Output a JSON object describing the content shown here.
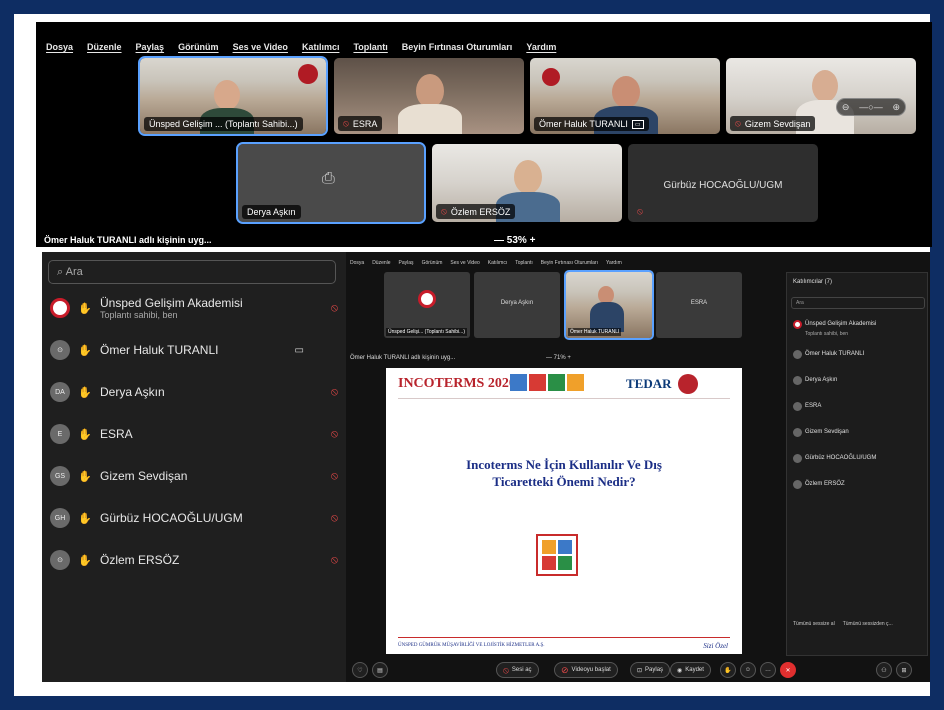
{
  "top_window": {
    "menu": [
      "Dosya",
      "Düzenle",
      "Paylaş",
      "Görünüm",
      "Ses ve Video",
      "Katılımcı",
      "Toplantı",
      "Beyin Fırtınası Oturumları",
      "Yardım"
    ],
    "tiles": [
      {
        "name": "Ünsped Gelişim ... (Toplantı Sahibi...)",
        "muted": false
      },
      {
        "name": "ESRA",
        "muted": true
      },
      {
        "name": "Ömer Haluk TURANLI",
        "muted": false
      },
      {
        "name": "Gizem Sevdişan",
        "muted": true
      },
      {
        "name": "Derya Aşkın",
        "muted": false
      },
      {
        "name": "Özlem ERSÖZ",
        "muted": true
      },
      {
        "name": "Gürbüz HOCAOĞLU/UGM",
        "muted": true
      }
    ],
    "share_info": "Ömer Haluk TURANLI adlı kişinin uyg...",
    "zoom": "—  53%  +"
  },
  "left_panel": {
    "search_placeholder": "Ara",
    "participants": [
      {
        "name": "Ünsped Gelişim Akademisi",
        "sub": "Toplantı sahibi, ben",
        "initials": ""
      },
      {
        "name": "Ömer Haluk TURANLI",
        "sub": "",
        "initials": ""
      },
      {
        "name": "Derya Aşkın",
        "sub": "",
        "initials": "DA"
      },
      {
        "name": "ESRA",
        "sub": "",
        "initials": "E"
      },
      {
        "name": "Gizem Sevdişan",
        "sub": "",
        "initials": "GS"
      },
      {
        "name": "Gürbüz HOCAOĞLU/UGM",
        "sub": "",
        "initials": "GH"
      },
      {
        "name": "Özlem ERSÖZ",
        "sub": "",
        "initials": ""
      }
    ]
  },
  "right_window": {
    "menu": [
      "Dosya",
      "Düzenle",
      "Paylaş",
      "Görünüm",
      "Ses ve Video",
      "Katılımcı",
      "Toplantı",
      "Beyin Fırtınası Oturumları",
      "Yardım"
    ],
    "tiles": [
      "Ünsped Gelişi... (Toplantı Sahibi...)",
      "Derya Aşkın",
      "Ömer Haluk TURANLI",
      "ESRA"
    ],
    "share_info": "Ömer Haluk TURANLI adlı kişinin uyg...",
    "zoom": "— 71% +",
    "slide": {
      "header": "INCOTERMS 2020",
      "brand": "TEDAR",
      "question": "Incoterms Ne İçin Kullanılır Ve Dış Ticaretteki Önemi Nedir?",
      "footer": "ÜNSPED GÜMRÜK MÜŞAVİRLİĞİ VE LOJİSTİK HİZMETLER A.Ş.",
      "signature": "Sizi Özel"
    },
    "controls": {
      "audio": "Sesi aç",
      "video": "Videoyu başlat",
      "share": "Paylaş",
      "record": "Kaydet"
    },
    "panel": {
      "title": "Katılımcılar (7)",
      "search": "Ara",
      "items": [
        "Ünsped Gelişim Akademisi",
        "Ömer Haluk TURANLI",
        "Derya Aşkın",
        "ESRA",
        "Gizem Sevdişan",
        "Gürbüz HOCAOĞLU/UGM",
        "Özlem ERSÖZ"
      ],
      "item0_sub": "Toplantı sahibi, ben",
      "mute_all": "Tümünü sessize al",
      "unmute_all": "Tümünü sessizden ç..."
    }
  },
  "colors": {
    "background": "#0e2d63",
    "muted": "#e54848",
    "selected": "#5aa1ff",
    "end": "#e02f2f"
  }
}
